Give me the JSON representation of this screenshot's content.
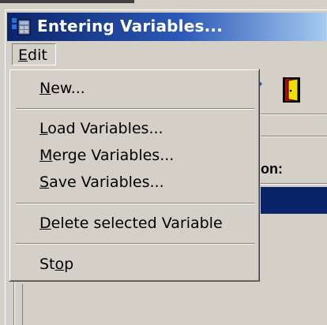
{
  "window": {
    "title": "Entering Variables..."
  },
  "menubar": {
    "edit": {
      "prefix": "",
      "accel": "E",
      "rest": "dit"
    }
  },
  "dropdown": {
    "items": [
      {
        "accel": "N",
        "rest": "ew..."
      },
      {
        "accel": "L",
        "rest": "oad Variables..."
      },
      {
        "accel": "M",
        "rest": "erge Variables..."
      },
      {
        "accel": "S",
        "rest": "ave Variables..."
      },
      {
        "accel": "D",
        "rest": "elete selected Variable"
      },
      {
        "pre": "St",
        "accel": "o",
        "rest": "p"
      }
    ]
  },
  "background": {
    "field_label": "on:"
  },
  "colors": {
    "titlebar_start": "#0a246a",
    "titlebar_end": "#a6caf0",
    "selection": "#0a246a",
    "face": "#d4d0c8"
  }
}
